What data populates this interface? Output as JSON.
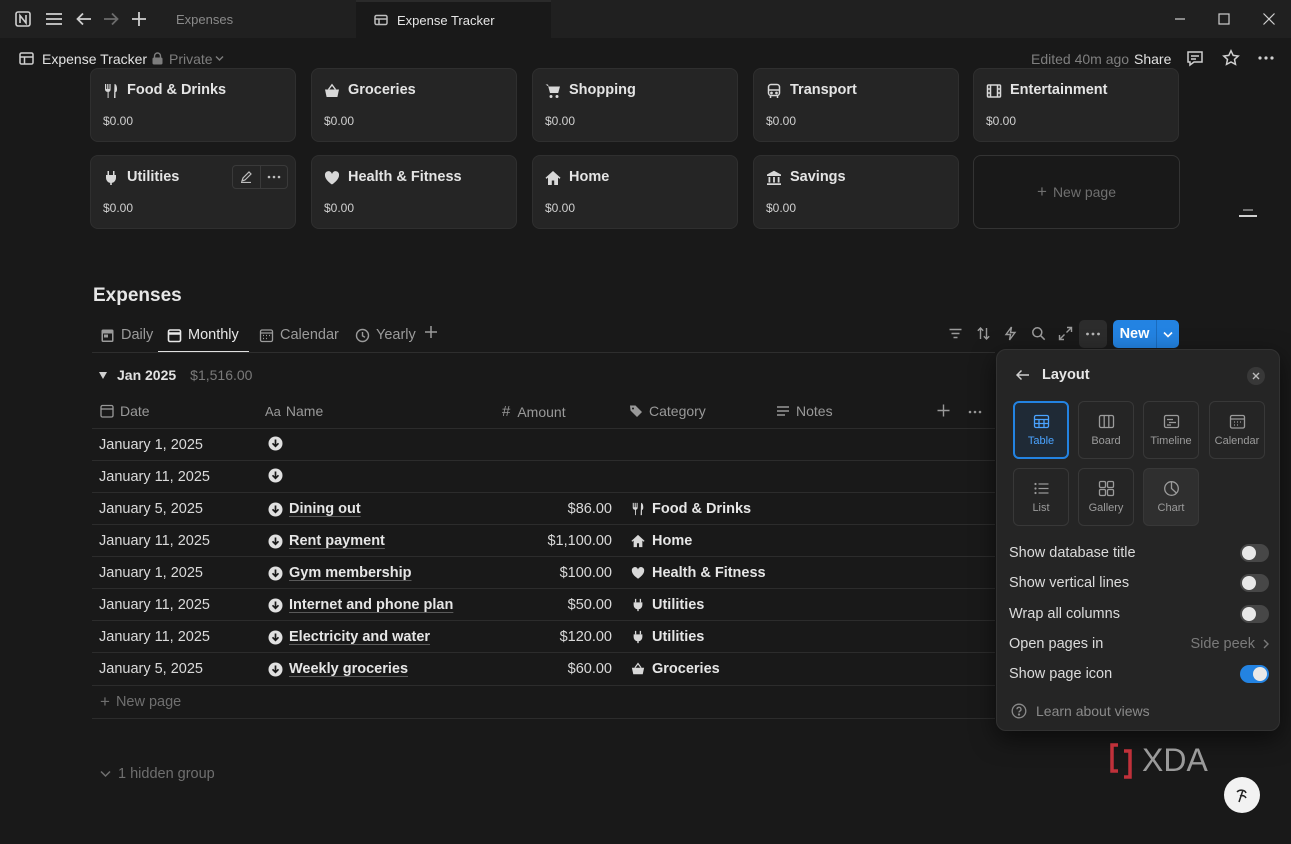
{
  "titlebar": {
    "tabs": [
      {
        "label": "Expenses",
        "active": false
      },
      {
        "label": "Expense Tracker",
        "active": true
      }
    ]
  },
  "header": {
    "page_title": "Expense Tracker",
    "privacy": "Private",
    "edited": "Edited 40m ago",
    "share_label": "Share"
  },
  "cards": [
    {
      "name": "Food & Drinks",
      "amount": "$0.00",
      "icon": "fork-knife-icon"
    },
    {
      "name": "Groceries",
      "amount": "$0.00",
      "icon": "basket-icon"
    },
    {
      "name": "Shopping",
      "amount": "$0.00",
      "icon": "cart-icon"
    },
    {
      "name": "Transport",
      "amount": "$0.00",
      "icon": "bus-icon"
    },
    {
      "name": "Entertainment",
      "amount": "$0.00",
      "icon": "film-icon"
    },
    {
      "name": "Utilities",
      "amount": "$0.00",
      "icon": "plug-icon"
    },
    {
      "name": "Health & Fitness",
      "amount": "$0.00",
      "icon": "heart-icon"
    },
    {
      "name": "Home",
      "amount": "$0.00",
      "icon": "home-icon"
    },
    {
      "name": "Savings",
      "amount": "$0.00",
      "icon": "bank-icon"
    }
  ],
  "new_page_label": "New page",
  "expenses": {
    "title": "Expenses",
    "views": [
      {
        "label": "Daily",
        "active": false
      },
      {
        "label": "Monthly",
        "active": true
      },
      {
        "label": "Calendar",
        "active": false
      },
      {
        "label": "Yearly",
        "active": false
      }
    ],
    "new_button": "New",
    "group": {
      "name": "Jan 2025",
      "sum": "$1,516.00"
    },
    "columns": [
      "Date",
      "Name",
      "Amount",
      "Category",
      "Notes"
    ],
    "rows": [
      {
        "date": "January 1, 2025",
        "name": "",
        "amount": "",
        "category": ""
      },
      {
        "date": "January 11, 2025",
        "name": "",
        "amount": "",
        "category": ""
      },
      {
        "date": "January 5, 2025",
        "name": "Dining out",
        "amount": "$86.00",
        "category": "Food & Drinks",
        "cat_icon": "fork-knife-icon"
      },
      {
        "date": "January 11, 2025",
        "name": "Rent payment",
        "amount": "$1,100.00",
        "category": "Home",
        "cat_icon": "home-icon"
      },
      {
        "date": "January 1, 2025",
        "name": "Gym membership",
        "amount": "$100.00",
        "category": "Health & Fitness",
        "cat_icon": "heart-icon"
      },
      {
        "date": "January 11, 2025",
        "name": "Internet and phone plan",
        "amount": "$50.00",
        "category": "Utilities",
        "cat_icon": "plug-icon"
      },
      {
        "date": "January 11, 2025",
        "name": "Electricity and water",
        "amount": "$120.00",
        "category": "Utilities",
        "cat_icon": "plug-icon"
      },
      {
        "date": "January 5, 2025",
        "name": "Weekly groceries",
        "amount": "$60.00",
        "category": "Groceries",
        "cat_icon": "basket-icon"
      }
    ],
    "new_row_label": "New page",
    "hidden_group_label": "1 hidden group"
  },
  "layout_panel": {
    "title": "Layout",
    "options": [
      {
        "label": "Table",
        "selected": true
      },
      {
        "label": "Board",
        "selected": false
      },
      {
        "label": "Timeline",
        "selected": false
      },
      {
        "label": "Calendar",
        "selected": false
      },
      {
        "label": "List",
        "selected": false
      },
      {
        "label": "Gallery",
        "selected": false
      },
      {
        "label": "Chart",
        "selected": false
      }
    ],
    "settings": [
      {
        "label": "Show database title",
        "on": false
      },
      {
        "label": "Show vertical lines",
        "on": false
      },
      {
        "label": "Wrap all columns",
        "on": false
      },
      {
        "label": "Open pages in",
        "value": "Side peek"
      },
      {
        "label": "Show page icon",
        "on": true
      }
    ],
    "learn_label": "Learn about views"
  },
  "colors": {
    "accent": "#2383e2",
    "background": "#191919",
    "card": "#252525"
  },
  "watermark": "XDA"
}
